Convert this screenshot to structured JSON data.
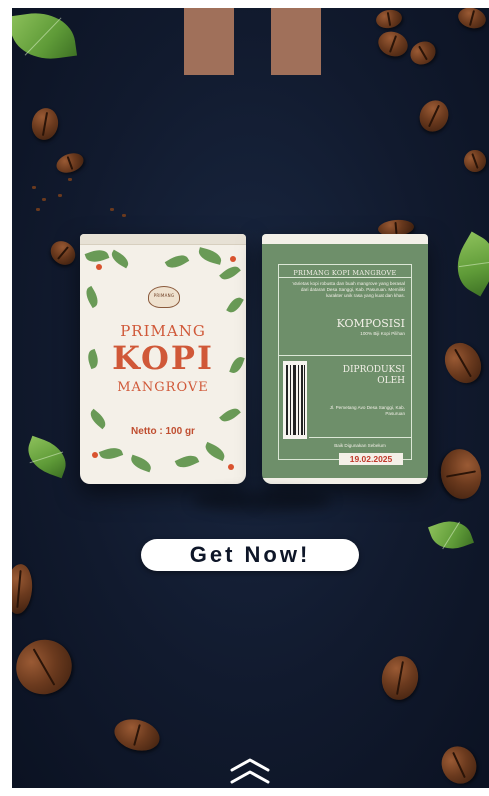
{
  "product": {
    "brand_small": "PRIMANG",
    "name_line1": "PRIMANG",
    "name_line2": "KOPI",
    "name_line3": "MANGROVE",
    "netto": "Netto : 100 gr"
  },
  "back_label": {
    "title": "PRIMANG KOPI MANGROVE",
    "description": "Varietas kopi robusta dan buah mangrove yang berasal dari dataran Desa Sanggi, Kab. Pasuruan. Memiliki karakter unik rasa yang kuat dan khas.",
    "composition_heading": "KOMPOSISI",
    "composition_value": "100% Biji Kopi Pilihan",
    "producer_heading_1": "DIPRODUKSI",
    "producer_heading_2": "OLEH",
    "address": "Jl. Pemetang Avo Desa Sanggi, Kab. Pasuruan",
    "best_before_label": "Baik Digunakan Sebelum",
    "best_before_date": "19.02.2025"
  },
  "cta": {
    "label": "Get Now!"
  },
  "icons": {
    "scroll_up": "double-chevron-up-icon"
  },
  "colors": {
    "background": "#111a2e",
    "accent_red": "#d05838",
    "back_green": "#6e8f6a",
    "tab_brown": "#a0705a"
  }
}
